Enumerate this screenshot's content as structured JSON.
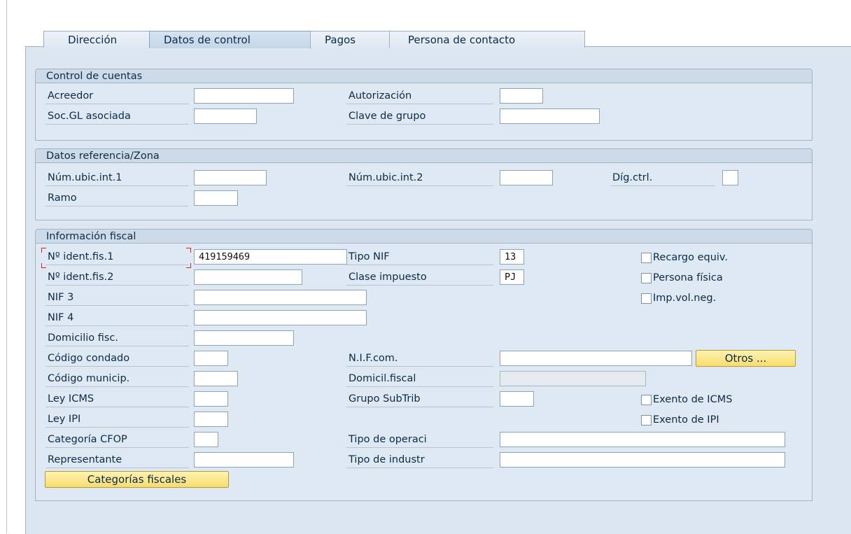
{
  "tabs": [
    "Dirección",
    "Datos de control",
    "Pagos",
    "Persona de contacto"
  ],
  "active_tab": "Datos de control",
  "control_cuentas": {
    "title": "Control de cuentas",
    "acreedor_label": "Acreedor",
    "acreedor_value": "",
    "soc_gl_label": "Soc.GL asociada",
    "soc_gl_value": "",
    "autorizacion_label": "Autorización",
    "autorizacion_value": "",
    "clave_grupo_label": "Clave de grupo",
    "clave_grupo_value": ""
  },
  "datos_referencia": {
    "title": "Datos referencia/Zona",
    "ubic1_label": "Núm.ubic.int.1",
    "ubic1_value": "",
    "ubic2_label": "Núm.ubic.int.2",
    "ubic2_value": "",
    "digctrl_label": "Díg.ctrl.",
    "digctrl_value": "",
    "ramo_label": "Ramo",
    "ramo_value": ""
  },
  "info_fiscal": {
    "title": "Información fiscal",
    "nif1_label": "Nº ident.fis.1",
    "nif1_value": "419159469",
    "nif2_label": "Nº ident.fis.2",
    "nif2_value": "",
    "nif3_label": "NIF 3",
    "nif3_value": "",
    "nif4_label": "NIF 4",
    "nif4_value": "",
    "domicilio_label": "Domicilio fisc.",
    "domicilio_value": "",
    "condado_label": "Código condado",
    "condado_value": "",
    "municip_label": "Código municip.",
    "municip_value": "",
    "ley_icms_label": "Ley ICMS",
    "ley_icms_value": "",
    "ley_ipi_label": "Ley IPI",
    "ley_ipi_value": "",
    "cfop_label": "Categoría CFOP",
    "cfop_value": "",
    "representante_label": "Representante",
    "representante_value": "",
    "tipo_nif_label": "Tipo NIF",
    "tipo_nif_value": "13",
    "clase_impuesto_label": "Clase impuesto",
    "clase_impuesto_value": "PJ",
    "nif_com_label": "N.I.F.com.",
    "nif_com_value": "",
    "domicil_fiscal_label": "Domicil.fiscal",
    "domicil_fiscal_value": "",
    "grupo_subtrib_label": "Grupo SubTrib",
    "grupo_subtrib_value": "",
    "tipo_operaci_label": "Tipo de operaci",
    "tipo_operaci_value": "",
    "tipo_industr_label": "Tipo de industr",
    "tipo_industr_value": "",
    "recargo_label": "Recargo equiv.",
    "persona_fisica_label": "Persona física",
    "imp_vol_label": "Imp.vol.neg.",
    "exento_icms_label": "Exento de ICMS",
    "exento_ipi_label": "Exento de IPI",
    "otros_button": "Otros ...",
    "categorias_button": "Categorías fiscales"
  }
}
